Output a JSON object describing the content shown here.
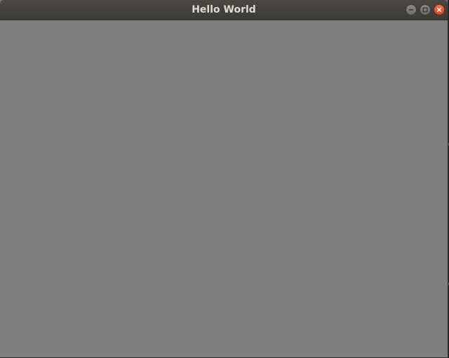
{
  "window": {
    "title": "Hello World",
    "controls": {
      "minimize_icon": "minimize-icon",
      "maximize_icon": "maximize-icon",
      "close_icon": "close-icon"
    }
  },
  "colors": {
    "titlebar": "#3c3b37",
    "title_text": "#dfdbd2",
    "content_background": "#7f7f7f",
    "close_button": "#e95420"
  }
}
